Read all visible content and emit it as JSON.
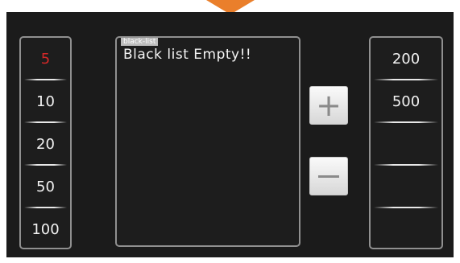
{
  "left_list": {
    "items": [
      "5",
      "10",
      "20",
      "50",
      "100"
    ],
    "selected_index": 0
  },
  "right_list": {
    "items": [
      "200",
      "500",
      "",
      "",
      ""
    ]
  },
  "blacklist": {
    "tag": "black-list",
    "message": "Black list Empty!!"
  },
  "buttons": {
    "add_label": "+",
    "remove_icon": "minus-icon"
  },
  "colors": {
    "selected_text": "#d32828",
    "panel_bg": "#1b1b1b",
    "accent": "#ea7f2b"
  }
}
